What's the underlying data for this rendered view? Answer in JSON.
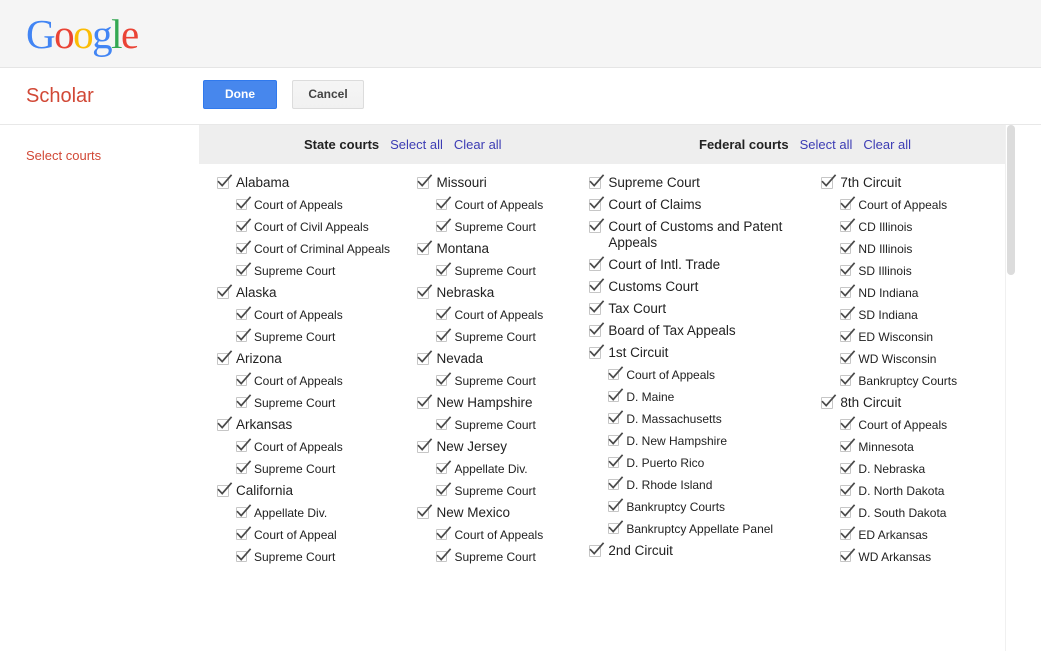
{
  "logo": {
    "letters": [
      "G",
      "o",
      "o",
      "g",
      "l",
      "e"
    ]
  },
  "header": {
    "scholar_title": "Scholar",
    "done_label": "Done",
    "cancel_label": "Cancel"
  },
  "sidebar": {
    "select_courts_label": "Select courts"
  },
  "panel_header": {
    "state_title": "State courts",
    "state_select_all": "Select all",
    "state_clear_all": "Clear all",
    "federal_title": "Federal courts",
    "federal_select_all": "Select all",
    "federal_clear_all": "Clear all"
  },
  "colors": {
    "accent_red": "#d14836",
    "link_blue": "#3c3cb4",
    "button_blue": "#4787ed",
    "header_gray": "#eeeeee",
    "logo_blue": "#4285f4",
    "logo_red": "#ea4335",
    "logo_yellow": "#fbbc05",
    "logo_green": "#34a853"
  },
  "state_courts": {
    "column1": [
      {
        "label": "Alabama",
        "level": "top",
        "checked": true
      },
      {
        "label": "Court of Appeals",
        "level": "sub",
        "checked": true
      },
      {
        "label": "Court of Civil Appeals",
        "level": "sub",
        "checked": true
      },
      {
        "label": "Court of Criminal Appeals",
        "level": "sub",
        "checked": true
      },
      {
        "label": "Supreme Court",
        "level": "sub",
        "checked": true
      },
      {
        "label": "Alaska",
        "level": "top",
        "checked": true
      },
      {
        "label": "Court of Appeals",
        "level": "sub",
        "checked": true
      },
      {
        "label": "Supreme Court",
        "level": "sub",
        "checked": true
      },
      {
        "label": "Arizona",
        "level": "top",
        "checked": true
      },
      {
        "label": "Court of Appeals",
        "level": "sub",
        "checked": true
      },
      {
        "label": "Supreme Court",
        "level": "sub",
        "checked": true
      },
      {
        "label": "Arkansas",
        "level": "top",
        "checked": true
      },
      {
        "label": "Court of Appeals",
        "level": "sub",
        "checked": true
      },
      {
        "label": "Supreme Court",
        "level": "sub",
        "checked": true
      },
      {
        "label": "California",
        "level": "top",
        "checked": true
      },
      {
        "label": "Appellate Div.",
        "level": "sub",
        "checked": true
      },
      {
        "label": "Court of Appeal",
        "level": "sub",
        "checked": true
      },
      {
        "label": "Supreme Court",
        "level": "sub",
        "checked": true
      }
    ],
    "column2": [
      {
        "label": "Missouri",
        "level": "top",
        "checked": true
      },
      {
        "label": "Court of Appeals",
        "level": "sub",
        "checked": true
      },
      {
        "label": "Supreme Court",
        "level": "sub",
        "checked": true
      },
      {
        "label": "Montana",
        "level": "top",
        "checked": true
      },
      {
        "label": "Supreme Court",
        "level": "sub",
        "checked": true
      },
      {
        "label": "Nebraska",
        "level": "top",
        "checked": true
      },
      {
        "label": "Court of Appeals",
        "level": "sub",
        "checked": true
      },
      {
        "label": "Supreme Court",
        "level": "sub",
        "checked": true
      },
      {
        "label": "Nevada",
        "level": "top",
        "checked": true
      },
      {
        "label": "Supreme Court",
        "level": "sub",
        "checked": true
      },
      {
        "label": "New Hampshire",
        "level": "top",
        "checked": true
      },
      {
        "label": "Supreme Court",
        "level": "sub",
        "checked": true
      },
      {
        "label": "New Jersey",
        "level": "top",
        "checked": true
      },
      {
        "label": "Appellate Div.",
        "level": "sub",
        "checked": true
      },
      {
        "label": "Supreme Court",
        "level": "sub",
        "checked": true
      },
      {
        "label": "New Mexico",
        "level": "top",
        "checked": true
      },
      {
        "label": "Court of Appeals",
        "level": "sub",
        "checked": true
      },
      {
        "label": "Supreme Court",
        "level": "sub",
        "checked": true
      }
    ]
  },
  "federal_courts": {
    "column1": [
      {
        "label": "Supreme Court",
        "level": "top",
        "checked": true
      },
      {
        "label": "Court of Claims",
        "level": "top",
        "checked": true
      },
      {
        "label": "Court of Customs and Patent Appeals",
        "level": "top",
        "checked": true
      },
      {
        "label": "Court of Intl. Trade",
        "level": "top",
        "checked": true
      },
      {
        "label": "Customs Court",
        "level": "top",
        "checked": true
      },
      {
        "label": "Tax Court",
        "level": "top",
        "checked": true
      },
      {
        "label": "Board of Tax Appeals",
        "level": "top",
        "checked": true
      },
      {
        "label": "1st Circuit",
        "level": "top",
        "checked": true
      },
      {
        "label": "Court of Appeals",
        "level": "sub",
        "checked": true
      },
      {
        "label": "D. Maine",
        "level": "sub",
        "checked": true
      },
      {
        "label": "D. Massachusetts",
        "level": "sub",
        "checked": true
      },
      {
        "label": "D. New Hampshire",
        "level": "sub",
        "checked": true
      },
      {
        "label": "D. Puerto Rico",
        "level": "sub",
        "checked": true
      },
      {
        "label": "D. Rhode Island",
        "level": "sub",
        "checked": true
      },
      {
        "label": "Bankruptcy Courts",
        "level": "sub",
        "checked": true
      },
      {
        "label": "Bankruptcy Appellate Panel",
        "level": "sub",
        "checked": true
      },
      {
        "label": "2nd Circuit",
        "level": "top",
        "checked": true
      }
    ],
    "column2": [
      {
        "label": "7th Circuit",
        "level": "top",
        "checked": true
      },
      {
        "label": "Court of Appeals",
        "level": "sub",
        "checked": true
      },
      {
        "label": "CD Illinois",
        "level": "sub",
        "checked": true
      },
      {
        "label": "ND Illinois",
        "level": "sub",
        "checked": true
      },
      {
        "label": "SD Illinois",
        "level": "sub",
        "checked": true
      },
      {
        "label": "ND Indiana",
        "level": "sub",
        "checked": true
      },
      {
        "label": "SD Indiana",
        "level": "sub",
        "checked": true
      },
      {
        "label": "ED Wisconsin",
        "level": "sub",
        "checked": true
      },
      {
        "label": "WD Wisconsin",
        "level": "sub",
        "checked": true
      },
      {
        "label": "Bankruptcy Courts",
        "level": "sub",
        "checked": true
      },
      {
        "label": "8th Circuit",
        "level": "top",
        "checked": true
      },
      {
        "label": "Court of Appeals",
        "level": "sub",
        "checked": true
      },
      {
        "label": "Minnesota",
        "level": "sub",
        "checked": true
      },
      {
        "label": "D. Nebraska",
        "level": "sub",
        "checked": true
      },
      {
        "label": "D. North Dakota",
        "level": "sub",
        "checked": true
      },
      {
        "label": "D. South Dakota",
        "level": "sub",
        "checked": true
      },
      {
        "label": "ED Arkansas",
        "level": "sub",
        "checked": true
      },
      {
        "label": "WD Arkansas",
        "level": "sub",
        "checked": true
      }
    ]
  }
}
